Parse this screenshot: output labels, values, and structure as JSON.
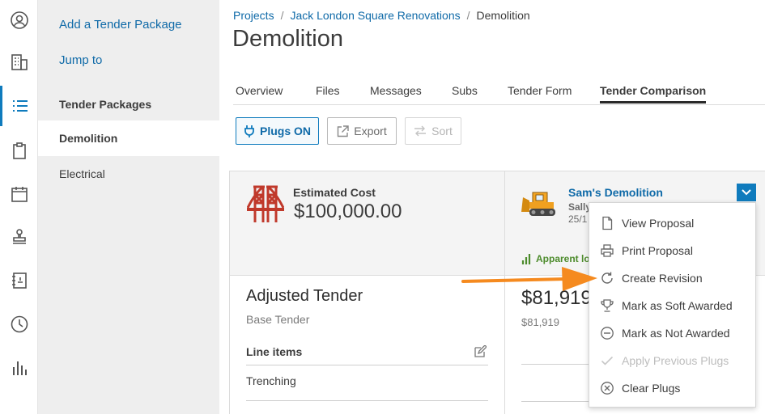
{
  "sidebar": {
    "add_link": "Add a Tender Package",
    "jump_link": "Jump to",
    "section_heading": "Tender Packages",
    "items": [
      {
        "label": "Demolition"
      },
      {
        "label": "Electrical"
      }
    ]
  },
  "breadcrumb": {
    "projects": "Projects",
    "project": "Jack London Square Renovations",
    "current": "Demolition",
    "separator": "/"
  },
  "page_title": "Demolition",
  "tabs": [
    {
      "label": "Overview"
    },
    {
      "label": "Files"
    },
    {
      "label": "Messages"
    },
    {
      "label": "Subs"
    },
    {
      "label": "Tender Form"
    },
    {
      "label": "Tender Comparison"
    }
  ],
  "toolbar": {
    "plugs_label": "Plugs ON",
    "export_label": "Export",
    "sort_label": "Sort"
  },
  "estimate": {
    "label": "Estimated Cost",
    "value": "$100,000.00",
    "icon": "bridge-icon"
  },
  "adjusted": {
    "title": "Adjusted Tender",
    "subtitle": "Base Tender",
    "line_items_heading": "Line items",
    "rows": [
      {
        "label": "Trenching"
      }
    ]
  },
  "vendor": {
    "name": "Sam's Demolition",
    "contact": "Sally",
    "date": "25/1",
    "apparent_low": "Apparent lo",
    "amount": "$81,919",
    "amount_sub": "$81,919",
    "icon": "bulldozer-icon"
  },
  "menu": {
    "items": [
      {
        "label": "View Proposal",
        "icon": "document-icon",
        "enabled": true
      },
      {
        "label": "Print Proposal",
        "icon": "printer-icon",
        "enabled": true
      },
      {
        "label": "Create Revision",
        "icon": "refresh-icon",
        "enabled": true
      },
      {
        "label": "Mark as Soft Awarded",
        "icon": "trophy-icon",
        "enabled": true
      },
      {
        "label": "Mark as Not Awarded",
        "icon": "minus-circle-icon",
        "enabled": true
      },
      {
        "label": "Apply Previous Plugs",
        "icon": "check-icon",
        "enabled": false
      },
      {
        "label": "Clear Plugs",
        "icon": "x-circle-icon",
        "enabled": true
      }
    ]
  },
  "colors": {
    "accent": "#0f7bbd",
    "link": "#0f6aa8",
    "annotation_arrow": "#f58a1f",
    "success": "#4c8b2b"
  }
}
